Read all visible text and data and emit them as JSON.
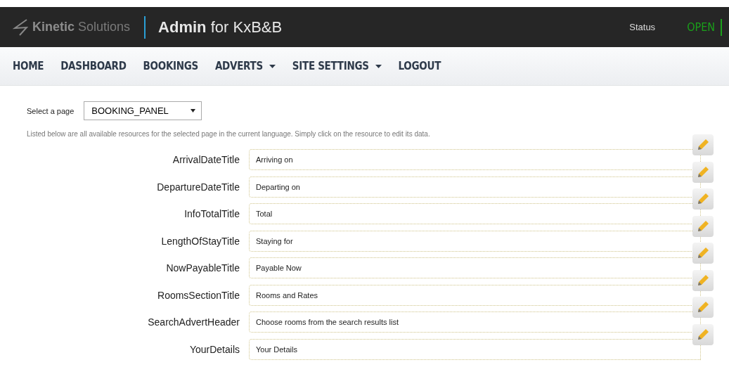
{
  "header": {
    "brand_bold": "Kinetic",
    "brand_light": "Solutions",
    "title_bold": "Admin",
    "title_rest": "for KxB&B",
    "status_label": "Status",
    "status_value": "OPEN"
  },
  "nav": [
    {
      "label": "HOME",
      "dropdown": false
    },
    {
      "label": "DASHBOARD",
      "dropdown": false
    },
    {
      "label": "BOOKINGS",
      "dropdown": false
    },
    {
      "label": "ADVERTS",
      "dropdown": true
    },
    {
      "label": "SITE SETTINGS",
      "dropdown": true
    },
    {
      "label": "LOGOUT",
      "dropdown": false
    }
  ],
  "page_select": {
    "label": "Select a page",
    "value": "BOOKING_PANEL"
  },
  "description": "Listed below are all available resources for the selected page in the current language. Simply click on the resource to edit its data.",
  "resources": [
    {
      "name": "ArrivalDateTitle",
      "value": "Arriving on"
    },
    {
      "name": "DepartureDateTitle",
      "value": "Departing on"
    },
    {
      "name": "InfoTotalTitle",
      "value": "Total"
    },
    {
      "name": "LengthOfStayTitle",
      "value": "Staying for"
    },
    {
      "name": "NowPayableTitle",
      "value": "Payable Now"
    },
    {
      "name": "RoomsSectionTitle",
      "value": "Rooms and Rates"
    },
    {
      "name": "SearchAdvertHeader",
      "value": "Choose rooms from the search results list"
    },
    {
      "name": "YourDetails",
      "value": "Your Details"
    }
  ]
}
